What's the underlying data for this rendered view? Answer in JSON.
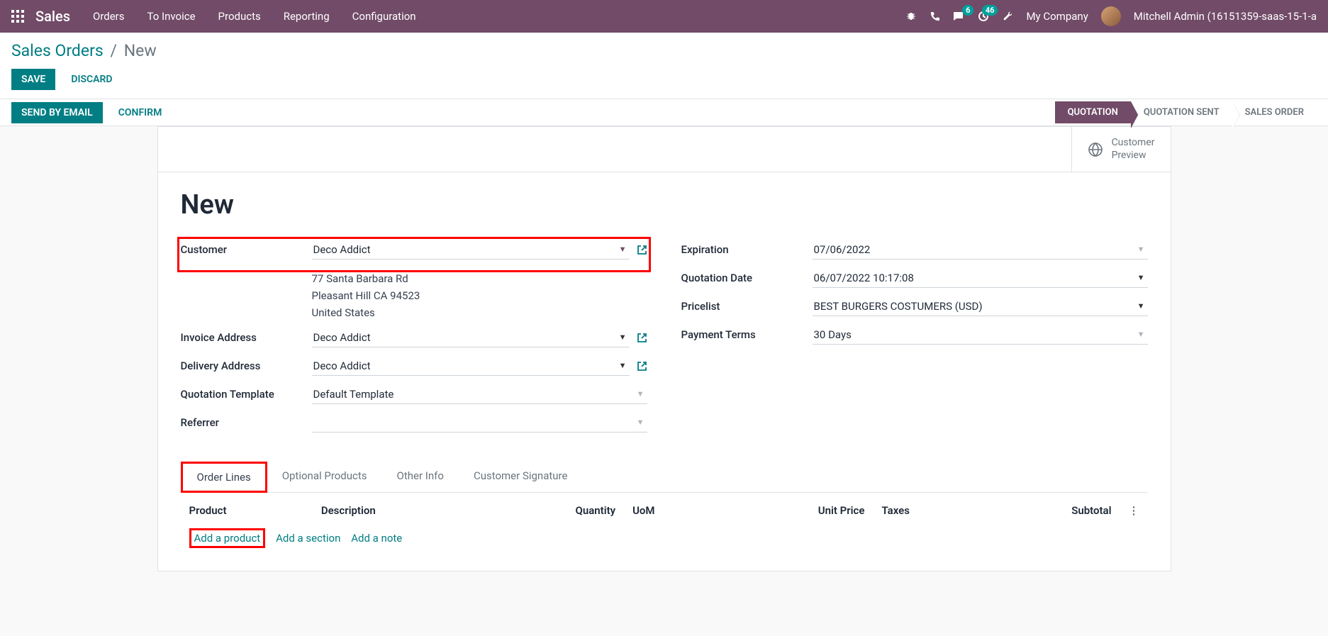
{
  "navbar": {
    "brand": "Sales",
    "menu": [
      "Orders",
      "To Invoice",
      "Products",
      "Reporting",
      "Configuration"
    ],
    "messages_badge": "6",
    "activities_badge": "46",
    "company": "My Company",
    "user": "Mitchell Admin (16151359-saas-15-1-a"
  },
  "breadcrumbs": {
    "parent": "Sales Orders",
    "current": "New"
  },
  "buttons": {
    "save": "SAVE",
    "discard": "DISCARD",
    "send_email": "SEND BY EMAIL",
    "confirm": "CONFIRM"
  },
  "stages": {
    "quotation": "QUOTATION",
    "quotation_sent": "QUOTATION SENT",
    "sales_order": "SALES ORDER"
  },
  "preview": {
    "line1": "Customer",
    "line2": "Preview"
  },
  "form": {
    "title": "New",
    "labels": {
      "customer": "Customer",
      "invoice_address": "Invoice Address",
      "delivery_address": "Delivery Address",
      "quotation_template": "Quotation Template",
      "referrer": "Referrer",
      "expiration": "Expiration",
      "quotation_date": "Quotation Date",
      "pricelist": "Pricelist",
      "payment_terms": "Payment Terms"
    },
    "values": {
      "customer": "Deco Addict",
      "address_line1": "77 Santa Barbara Rd",
      "address_line2": "Pleasant Hill CA 94523",
      "address_line3": "United States",
      "invoice_address": "Deco Addict",
      "delivery_address": "Deco Addict",
      "quotation_template": "Default Template",
      "referrer": "",
      "expiration": "07/06/2022",
      "quotation_date": "06/07/2022 10:17:08",
      "pricelist": "BEST BURGERS COSTUMERS (USD)",
      "payment_terms": "30 Days"
    }
  },
  "tabs": {
    "order_lines": "Order Lines",
    "optional_products": "Optional Products",
    "other_info": "Other Info",
    "customer_signature": "Customer Signature"
  },
  "table": {
    "headers": {
      "product": "Product",
      "description": "Description",
      "quantity": "Quantity",
      "uom": "UoM",
      "unit_price": "Unit Price",
      "taxes": "Taxes",
      "subtotal": "Subtotal"
    },
    "add_product": "Add a product",
    "add_section": "Add a section",
    "add_note": "Add a note"
  }
}
